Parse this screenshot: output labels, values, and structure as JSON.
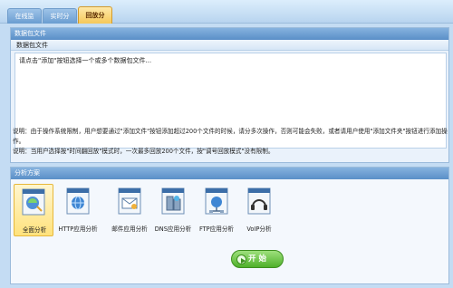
{
  "tabs": [
    {
      "label": "在线监测"
    },
    {
      "label": "实时分析"
    },
    {
      "label": "回放分析"
    }
  ],
  "file_panel": {
    "title": "数据包文件",
    "column_header": "数据包文件",
    "placeholder_text": "请点击\"添加\"按钮选择一个或多个数据包文件...",
    "note1": "说明：由于操作系统限制，用户想要通过\"添加文件\"按钮添加超过200个文件的时候，请分多次操作，否则可能会失败，或者请用户使用\"添加文件夹\"按钮进行添加操作。",
    "note2": "说明：当用户选择按\"时间翻回放\"模式时，一次最多回放200个文件，按\"调号回放模式\"没有限制。"
  },
  "analysis_panel": {
    "title": "分析方案",
    "plans": [
      {
        "label": "全面分析",
        "icon": "full-analysis-icon",
        "selected": true
      },
      {
        "label": "HTTP应用分析",
        "icon": "http-analysis-icon",
        "selected": false
      },
      {
        "label": "邮件应用分析",
        "icon": "mail-analysis-icon",
        "selected": false
      },
      {
        "label": "DNS应用分析",
        "icon": "dns-analysis-icon",
        "selected": false
      },
      {
        "label": "FTP应用分析",
        "icon": "ftp-analysis-icon",
        "selected": false
      },
      {
        "label": "VoIP分析",
        "icon": "voip-analysis-icon",
        "selected": false
      }
    ],
    "start_label": "开 始"
  },
  "colors": {
    "accent": "#5a8fc7",
    "active_tab": "#f5c85a",
    "start_button": "#4fb02a"
  }
}
